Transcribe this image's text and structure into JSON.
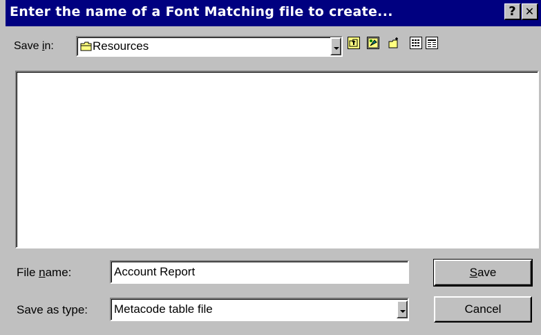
{
  "window": {
    "title": "Enter the name of a Font Matching file to create...",
    "help_glyph": "?",
    "close_glyph": "✕"
  },
  "save_in": {
    "label_pre": "Save ",
    "label_ul": "i",
    "label_post": "n:",
    "value": "Resources",
    "toolbar_icons": [
      "up-one-level-icon",
      "desktop-icon",
      "new-folder-icon",
      "list-view-icon",
      "details-view-icon"
    ]
  },
  "file_name": {
    "label_pre": "File ",
    "label_ul": "n",
    "label_post": "ame:",
    "value": "Account Report"
  },
  "save_as_type": {
    "label": "Save as type:",
    "value": "Metacode table file"
  },
  "buttons": {
    "save_ul": "S",
    "save_rest": "ave",
    "cancel": "Cancel"
  }
}
